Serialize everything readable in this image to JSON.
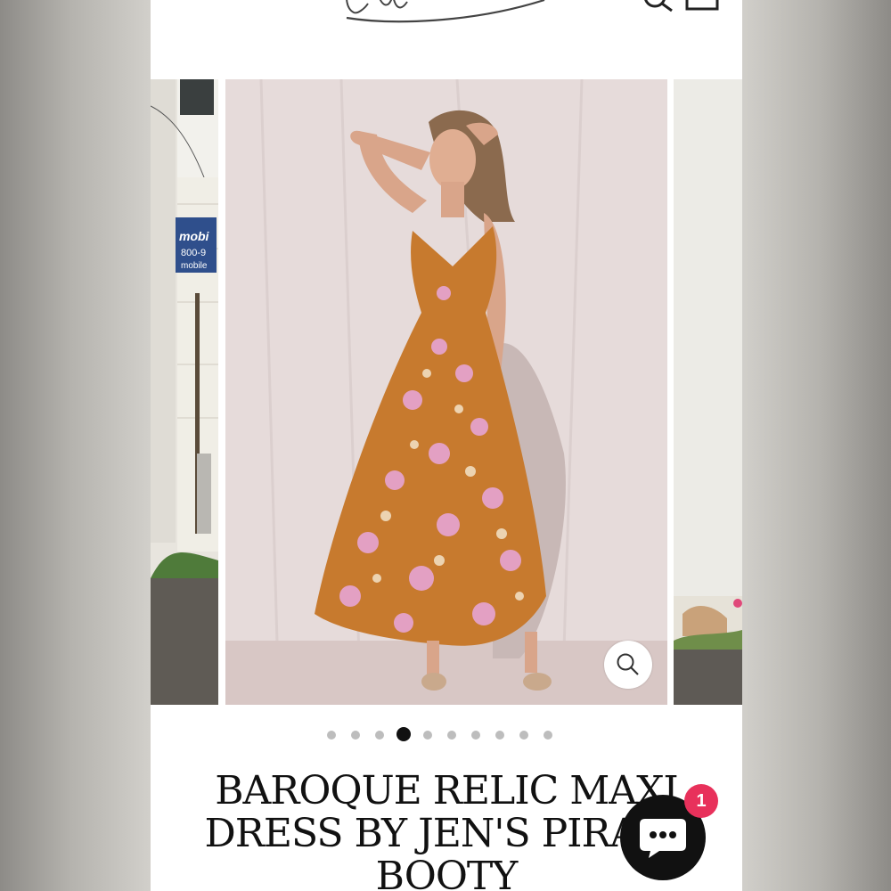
{
  "header": {
    "menu_icon": "hamburger-icon",
    "search_icon": "search-icon",
    "cart_icon": "cart-icon"
  },
  "gallery": {
    "total_slides": 10,
    "active_index": 3,
    "zoom_icon": "zoom-icon",
    "photo_sign_lines": [
      "mobi",
      "800-9",
      "mobile"
    ]
  },
  "product": {
    "title": "BAROQUE RELIC MAXI DRESS BY JEN'S PIRATE BOOTY"
  },
  "chat": {
    "icon": "chat-bubble-icon",
    "badge_count": "1"
  },
  "colors": {
    "accent": "#e8315b",
    "text": "#111111",
    "dot_inactive": "#bdbdbd",
    "dress": "#c77a2e",
    "flower": "#e7a5d4"
  }
}
